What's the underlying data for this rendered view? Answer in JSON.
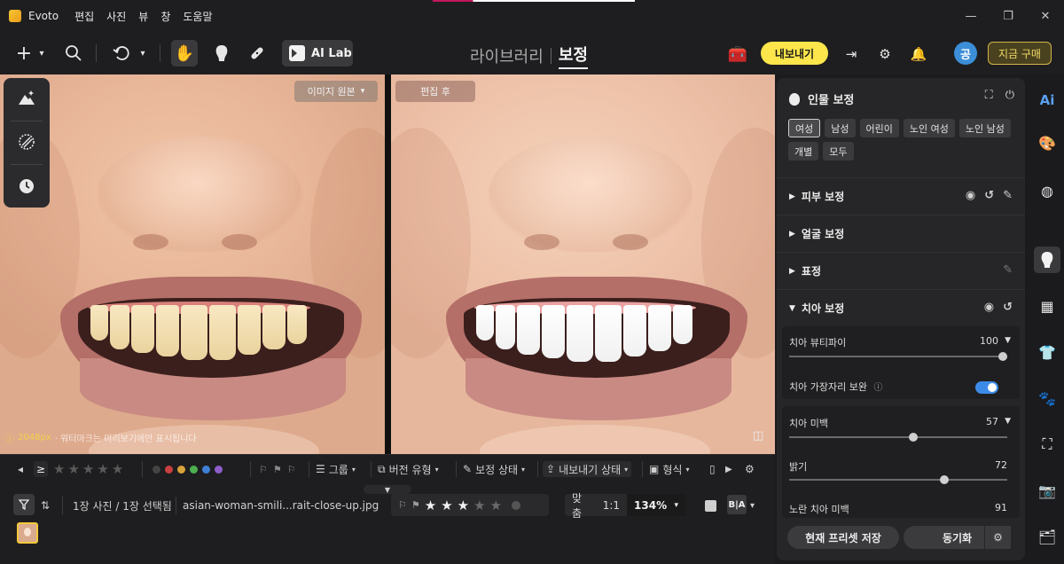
{
  "app": {
    "name": "Evoto",
    "menu": [
      "편집",
      "사진",
      "뷰",
      "창",
      "도움말"
    ],
    "window_controls": [
      "—",
      "❐",
      "✕"
    ]
  },
  "toolbar": {
    "ai_lab_label": "AI Lab",
    "tab_library": "라이브러리",
    "tab_edit": "보정",
    "export_label": "내보내기",
    "avatar_initial": "공",
    "buy_label": "지금 구매"
  },
  "canvas": {
    "original_label": "이미지 원본",
    "after_label": "편집 후",
    "resolution": "2048px",
    "watermark_text": "· 워터마크는 미리보기에만 표시됩니다"
  },
  "filmstrip": {
    "filter_ge": "≥",
    "color_labels": [
      "#444444",
      "#c94040",
      "#d9a23a",
      "#4caf50",
      "#3f7fd6",
      "#8d5dc9"
    ],
    "group_label": "그룹",
    "version_label": "버전 유형",
    "edit_status_label": "보정 상태",
    "export_status_label": "내보내기 상태",
    "format_label": "형식",
    "count_text": "1장 사진 / 1장 선택됨",
    "filename": "asian-woman-smili...rait-close-up.jpg",
    "rating": 3,
    "fit_label": "맞춤",
    "one_to_one": "1:1",
    "zoom": "134%"
  },
  "panel": {
    "title": "인물 보정",
    "chips": [
      "여성",
      "남성",
      "어린이",
      "노인 여성",
      "노인 남성",
      "개별",
      "모두"
    ],
    "active_chip": "여성",
    "sections": {
      "skin": "피부 보정",
      "face": "얼굴 보정",
      "expression": "표정",
      "teeth": "치아 보정"
    },
    "teeth_rows": {
      "beautify_label": "치아 뷰티파이",
      "beautify_value": "100",
      "edge_label": "치아 가장자리 보완",
      "edge_on": true,
      "whiten_label": "치아 미백",
      "whiten_value": "57",
      "brightness_label": "밝기",
      "brightness_value": "72",
      "yellow_label": "노란 치아 미백",
      "yellow_value": "91"
    },
    "save_preset_label": "현재 프리셋 저장",
    "sync_label": "동기화"
  },
  "rail": {
    "ai_label": "Ai"
  }
}
